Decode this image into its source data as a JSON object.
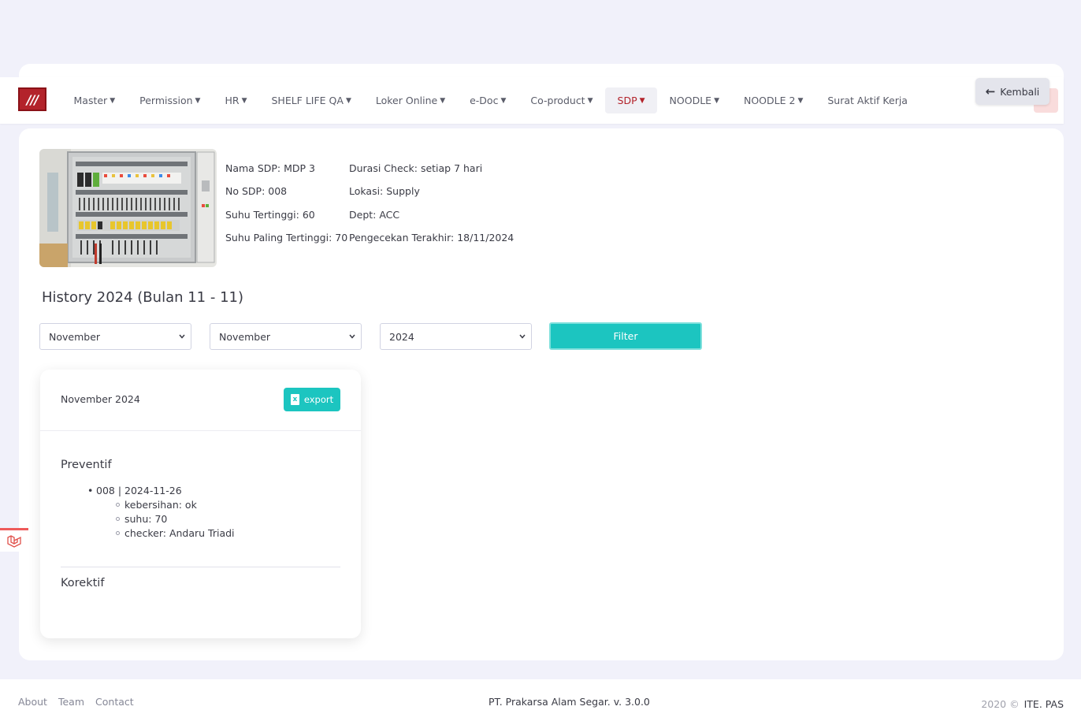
{
  "nav": {
    "brand": "///",
    "items": [
      {
        "label": "Master",
        "caret": true
      },
      {
        "label": "Permission",
        "caret": true
      },
      {
        "label": "HR",
        "caret": true
      },
      {
        "label": "SHELF LIFE QA",
        "caret": true
      },
      {
        "label": "Loker Online",
        "caret": true
      },
      {
        "label": "e-Doc",
        "caret": true
      },
      {
        "label": "Co-product",
        "caret": true
      },
      {
        "label": "SDP",
        "caret": true,
        "active": true
      },
      {
        "label": "NOODLE",
        "caret": true
      },
      {
        "label": "NOODLE 2",
        "caret": true
      },
      {
        "label": "Surat Aktif Kerja",
        "caret": false
      }
    ],
    "back_label": "Kembali"
  },
  "sdp": {
    "left": [
      "Nama SDP: MDP 3",
      "No SDP: 008",
      "Suhu Tertinggi: 60",
      "Suhu Paling Tertinggi: 70"
    ],
    "right": [
      "Durasi Check: setiap 7 hari",
      "Lokasi: Supply",
      "Dept: ACC",
      "Pengecekan Terakhir: 18/11/2024"
    ]
  },
  "history": {
    "title": "History 2024 (Bulan 11 - 11)",
    "filters": {
      "month_from": "November",
      "month_to": "November",
      "year": "2024",
      "filter_label": "Filter"
    }
  },
  "month_card": {
    "title": "November 2024",
    "export_label": "export",
    "preventif_title": "Preventif",
    "preventif_entry": "008 | 2024-11-26",
    "preventif_details": [
      "kebersihan: ok",
      "suhu: 70",
      "checker: Andaru Triadi"
    ],
    "korektif_title": "Korektif"
  },
  "footer": {
    "links": [
      "About",
      "Team",
      "Contact"
    ],
    "center": "PT. Prakarsa Alam Segar. v. 3.0.0",
    "year": "2020 ©",
    "right": "ITE. PAS"
  },
  "colors": {
    "brand_red": "#b3232b",
    "accent_teal": "#1cc5c0",
    "page_bg": "#f1f1fa"
  }
}
